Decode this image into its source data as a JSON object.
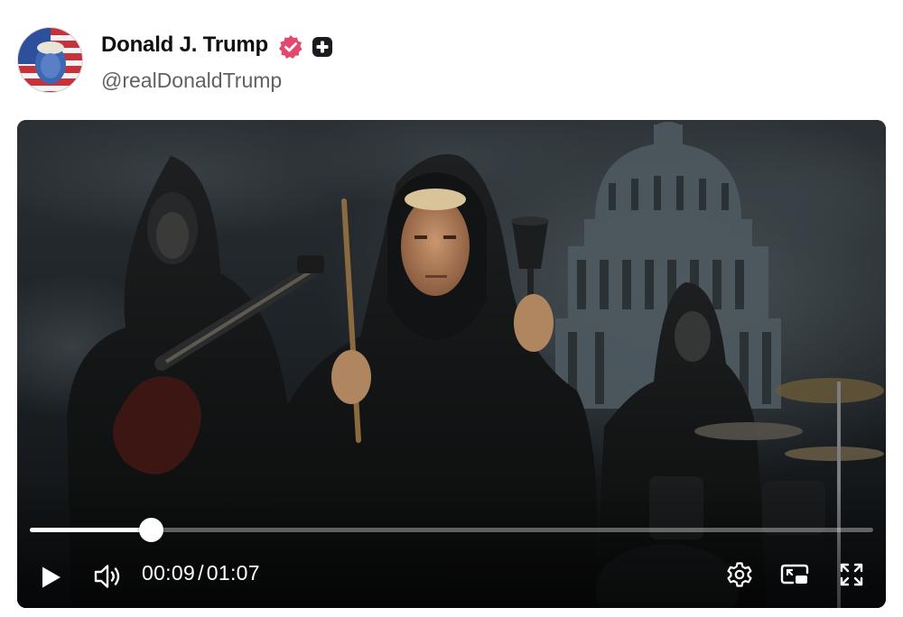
{
  "post": {
    "author_name": "Donald J. Trump",
    "author_handle": "@realDonaldTrump",
    "verified_badge_color": "#e5486d",
    "plus_badge_color": "#1a1a1f"
  },
  "video": {
    "current_time": "00:09",
    "separator": "/",
    "duration": "01:07",
    "progress_fraction": 0.143,
    "controls": {
      "play": "play-icon",
      "volume": "volume-icon",
      "settings": "gear-icon",
      "picture_in_picture": "picture-in-picture-icon",
      "fullscreen": "fullscreen-icon"
    }
  }
}
